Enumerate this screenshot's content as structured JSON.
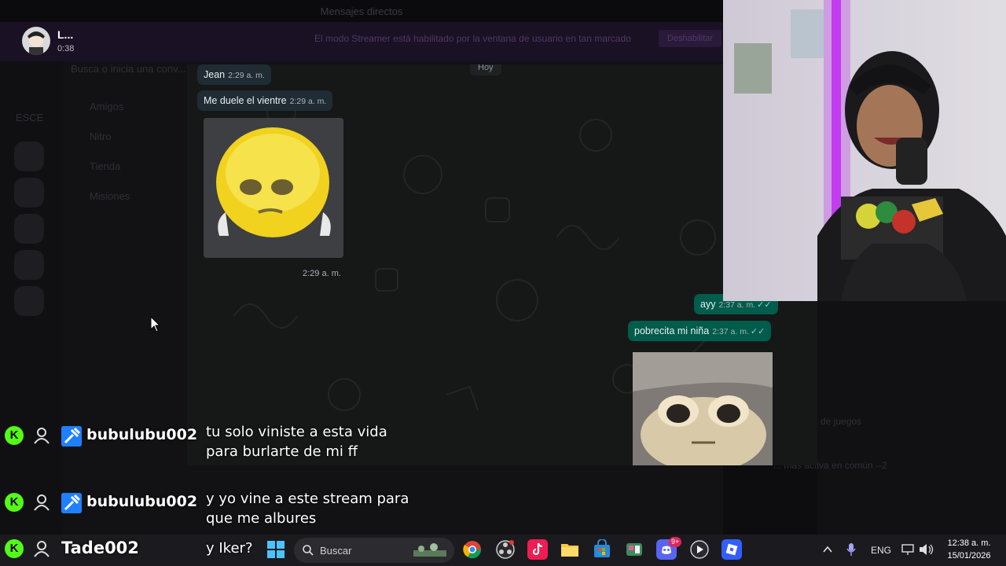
{
  "background": {
    "topbar_title": "Mensajes directos",
    "search_placeholder": "Busca o inicia una conv...",
    "nav_items": [
      "Amigos",
      "Nitro",
      "Tienda",
      "Misiones"
    ],
    "section_label": "ESCE",
    "right_panel_line1": "de juegos",
    "right_panel_line2": "... más activa en común --2"
  },
  "callbar": {
    "name": "L...",
    "timer": "0:38",
    "notice": "El modo Streamer está habilitado por la ventana de usuario en tan marcado",
    "button": "Deshabilitar"
  },
  "chat": {
    "day": "Hoy",
    "messages": [
      {
        "text": "Jean",
        "time": "2:29 a. m.",
        "dir": "in"
      },
      {
        "text": "Me duele el vientre",
        "time": "2:29 a. m.",
        "dir": "in"
      },
      {
        "sticker": "worried-emoji-sticker",
        "time": "2:29 a. m.",
        "dir": "in"
      },
      {
        "text": "ayy",
        "time": "2:37 a. m.",
        "dir": "out"
      },
      {
        "text": "pobrecita mi niña",
        "time": "2:37 a. m.",
        "dir": "out"
      },
      {
        "sticker": "frog-plush-sticker",
        "dir": "out"
      }
    ]
  },
  "stream_chat": [
    {
      "user": "bubulubu002",
      "message": "tu solo viniste a esta vida para burlarte de mi ff"
    },
    {
      "user": "bubulubu002",
      "message": "y yo vine a este stream para que me albures"
    },
    {
      "user": "Tade002",
      "message": "y Iker?"
    }
  ],
  "taskbar": {
    "search_label": "Buscar",
    "language": "ENG",
    "time": "12:38 a. m.",
    "date": "15/01/2026",
    "discord_badge": "9+"
  },
  "colors": {
    "kick_green": "#53fc18",
    "incoming_bubble": "#202c33",
    "outgoing_bubble": "#005c4b"
  }
}
